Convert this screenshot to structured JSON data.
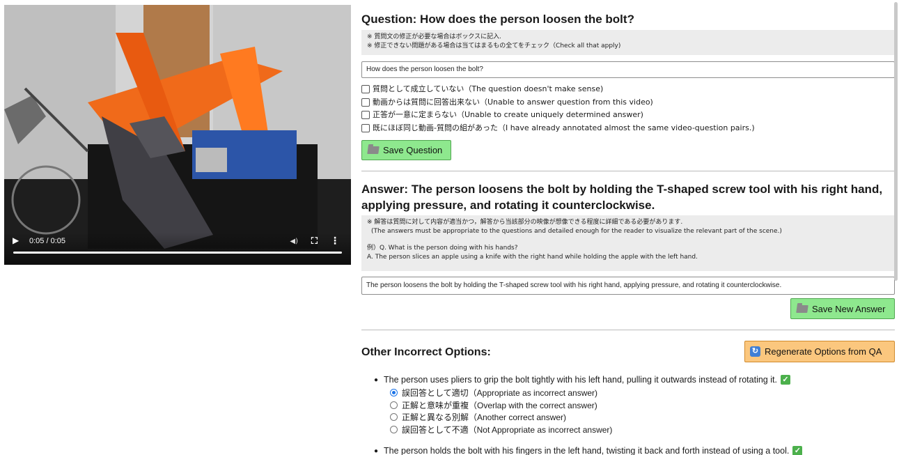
{
  "video": {
    "time": "0:05 / 0:05",
    "play_icon": "play-icon",
    "volume_icon": "volume-icon",
    "fullscreen_icon": "fullscreen-icon",
    "more_icon": "more-options-icon"
  },
  "question": {
    "title": "Question: How does the person loosen the bolt?",
    "note_line1": "※ 質問文の修正が必要な場合はボックスに記入.",
    "note_line2": "※ 修正できない問題がある場合は当てはまるもの全てをチェック（Check all that apply)",
    "input_value": "How does the person loosen the bolt?",
    "checks": [
      "質問として成立していない（The question doesn't make sense)",
      "動画からは質問に回答出来ない（Unable to answer question from this video)",
      "正答が一意に定まらない（Unable to create uniquely determined answer)",
      "既にほぼ同じ動画-質問の組があった（I have already annotated almost the same video-question pairs.)"
    ],
    "save_label": "Save Question"
  },
  "answer": {
    "title": "Answer: The person loosens the bolt by holding the T-shaped screw tool with his right hand, applying pressure, and rotating it counterclockwise.",
    "note_line1": "※ 解答は質問に対して内容が適当かつ，解答から当該部分の映像が想像できる程度に詳細である必要があります.",
    "note_line2": "(The answers must be appropriate to the questions and detailed enough for the reader to visualize the relevant part of the scene.)",
    "note_line3": "例）Q. What is the person doing with his hands?",
    "note_line4": "A. The person slices an apple using a knife with the right hand while holding the apple with the left hand.",
    "input_value": "The person loosens the bolt by holding the T-shaped screw tool with his right hand, applying pressure, and rotating it counterclockwise.",
    "save_label": "Save New Answer"
  },
  "options": {
    "title": "Other Incorrect Options:",
    "regenerate_label": "Regenerate Options from QA",
    "items": [
      {
        "text": "The person uses pliers to grip the bolt tightly with his left hand, pulling it outwards instead of rotating it.",
        "choices": [
          "誤回答として適切（Appropriate as incorrect answer)",
          "正解と意味が重複（Overlap with the correct answer)",
          "正解と異なる別解（Another correct answer)",
          "誤回答として不適（Not Appropriate as incorrect answer)"
        ],
        "selected": 0
      },
      {
        "text": "The person holds the bolt with his fingers in the left hand, twisting it back and forth instead of using a tool."
      }
    ]
  },
  "colors": {
    "save_green": "#8ee88e",
    "regenerate_orange": "#fbc77e",
    "note_bg": "#ececec",
    "radio_selected": "#1a73e8"
  }
}
